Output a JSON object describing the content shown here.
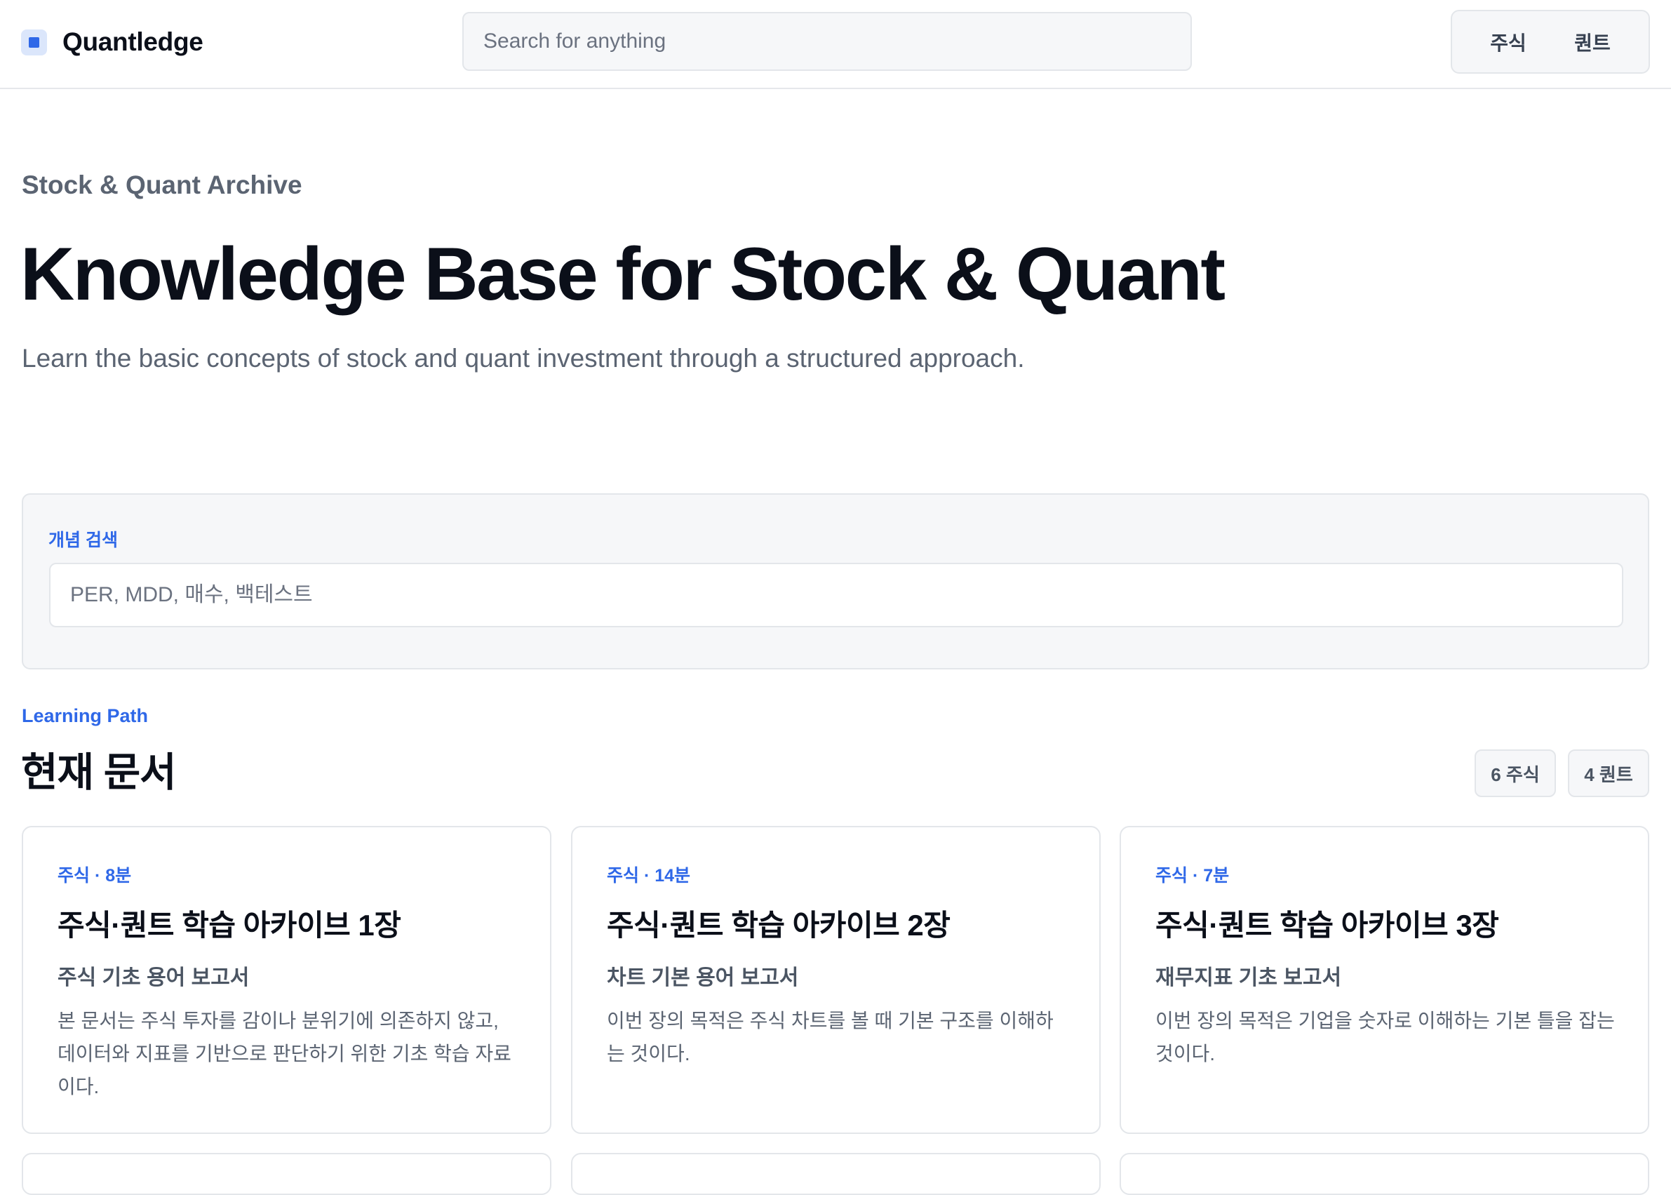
{
  "header": {
    "brand": "Quantledge",
    "search_placeholder": "Search for anything",
    "nav": [
      "주식",
      "퀀트"
    ]
  },
  "hero": {
    "eyebrow": "Stock & Quant Archive",
    "title": "Knowledge Base for Stock & Quant",
    "description": "Learn the basic concepts of stock and quant investment through a structured approach."
  },
  "concept_search": {
    "label": "개념 검색",
    "placeholder": "PER, MDD, 매수, 백테스트"
  },
  "learning_path": {
    "label": "Learning Path",
    "title": "현재 문서",
    "counts": [
      "6 주식",
      "4 퀀트"
    ]
  },
  "cards": [
    {
      "meta": "주식 · 8분",
      "title": "주식·퀀트 학습 아카이브 1장",
      "subtitle": "주식 기초 용어 보고서",
      "description": "본 문서는 주식 투자를 감이나 분위기에 의존하지 않고, 데이터와 지표를 기반으로 판단하기 위한 기초 학습 자료이다."
    },
    {
      "meta": "주식 · 14분",
      "title": "주식·퀀트 학습 아카이브 2장",
      "subtitle": "차트 기본 용어 보고서",
      "description": "이번 장의 목적은 주식 차트를 볼 때 기본 구조를 이해하는 것이다."
    },
    {
      "meta": "주식 · 7분",
      "title": "주식·퀀트 학습 아카이브 3장",
      "subtitle": "재무지표 기초 보고서",
      "description": "이번 장의 목적은 기업을 숫자로 이해하는 기본 틀을 잡는 것이다."
    }
  ],
  "theme": {
    "accent": "#2f68e8",
    "border": "#e3e6ea",
    "panel_bg": "#f6f7f9",
    "text_muted": "#5b6472"
  }
}
